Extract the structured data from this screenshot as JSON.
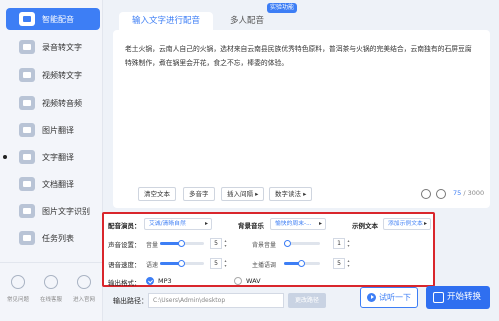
{
  "sidebar": {
    "items": [
      {
        "label": "智能配音",
        "icon": "microphone-icon",
        "active": true
      },
      {
        "label": "录音转文字",
        "icon": "record-to-text-icon"
      },
      {
        "label": "视频转文字",
        "icon": "video-to-text-icon"
      },
      {
        "label": "视频转音频",
        "icon": "video-to-audio-icon"
      },
      {
        "label": "图片翻译",
        "icon": "image-translate-icon"
      },
      {
        "label": "文字翻译",
        "icon": "text-translate-icon"
      },
      {
        "label": "文档翻译",
        "icon": "document-translate-icon"
      },
      {
        "label": "图片文字识别",
        "icon": "image-ocr-icon"
      },
      {
        "label": "任务列表",
        "icon": "task-list-icon"
      }
    ],
    "bottom": [
      {
        "label": "常见问题",
        "icon": "help-icon"
      },
      {
        "label": "在线客服",
        "icon": "support-icon"
      },
      {
        "label": "进入官网",
        "icon": "website-icon"
      }
    ]
  },
  "tabs": [
    {
      "label": "输入文字进行配音",
      "active": true
    },
    {
      "label": "多人配音",
      "active": false
    }
  ],
  "badge": "实验功能",
  "editor": {
    "text": "老土火锅，云南人自己的火锅，选材来自云南县民族优秀特色原料，普洱茶与火锅的完美结合，云南独有的石屏豆腐特殊制作，煮在锅里会开花，食之不忘，棒委的体验。",
    "tools": [
      "清空文本",
      "多音字",
      "插入间隔 ▸",
      "数字读法 ▸"
    ],
    "count_current": "75",
    "count_max": "/ 3000"
  },
  "settings": {
    "voice_label": "配音演员：",
    "voice_value": "艾诚/清晰自然",
    "bgm_label": "背景音乐",
    "bgm_value": "愉快的周末-...",
    "sample_label": "示例文本",
    "sample_value": "添加示例文本",
    "volume_label": "声音设置：",
    "volume_sub": "音量",
    "volume_value": "5",
    "volume_fraction": 0.5,
    "bg_volume_sub": "背景音量",
    "bg_volume_value": "1",
    "bg_volume_fraction": 0.1,
    "speed_label": "语音速度：",
    "speed_sub": "语速",
    "speed_value": "5",
    "speed_fraction": 0.5,
    "tempo_sub": "主播语调",
    "tempo_value": "5",
    "tempo_fraction": 0.5,
    "format_label": "输出格式：",
    "format_options": [
      {
        "label": "MP3",
        "checked": true
      },
      {
        "label": "WAV",
        "checked": false
      }
    ]
  },
  "output": {
    "label": "输出路径：",
    "path": "C:\\Users\\Admin\\desktop",
    "change_label": "更改路径",
    "listen_label": "试听一下",
    "convert_label": "开始转换"
  },
  "colors": {
    "accent": "#3d7ef5",
    "highlight_border": "#d9262c"
  }
}
